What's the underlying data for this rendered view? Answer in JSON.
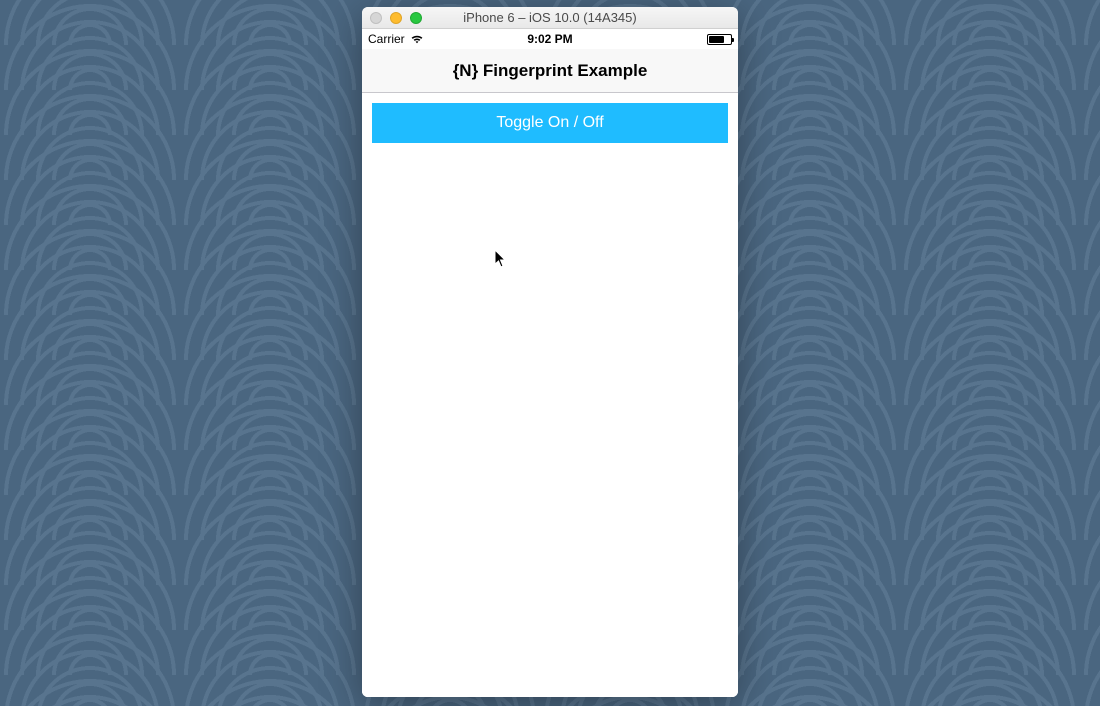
{
  "window": {
    "title": "iPhone 6 – iOS 10.0 (14A345)"
  },
  "status_bar": {
    "carrier": "Carrier",
    "time": "9:02 PM"
  },
  "nav": {
    "title": "{N} Fingerprint Example"
  },
  "content": {
    "toggle_button_label": "Toggle On / Off"
  },
  "colors": {
    "accent": "#1fbcff",
    "bg_wave_base": "#4a6680",
    "bg_wave_ring": "#5a7690"
  }
}
